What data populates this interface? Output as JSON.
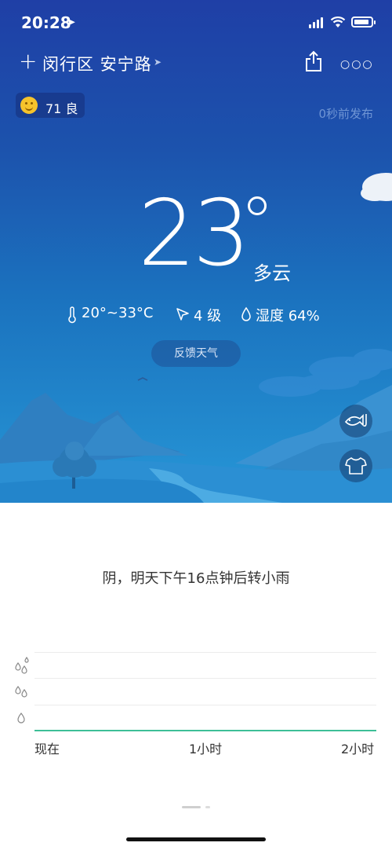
{
  "status_bar": {
    "time": "20:28"
  },
  "header": {
    "location": "闵行区 安宁路"
  },
  "aqi": {
    "value": "71 良"
  },
  "publish_time": "0秒前发布",
  "current": {
    "temperature": "23",
    "condition": "多云",
    "temp_range": "20°~33°C",
    "wind": "4 级",
    "humidity": "湿度 64%"
  },
  "feedback_label": "反馈天气",
  "forecast_text": "阴，明天下午16点钟后转小雨",
  "chart": {
    "x_labels": [
      "现在",
      "1小时",
      "2小时"
    ]
  },
  "colors": {
    "sky_top": "#1f3fa6",
    "sky_bottom": "#2797d8",
    "rain_line": "#3dbf97"
  }
}
